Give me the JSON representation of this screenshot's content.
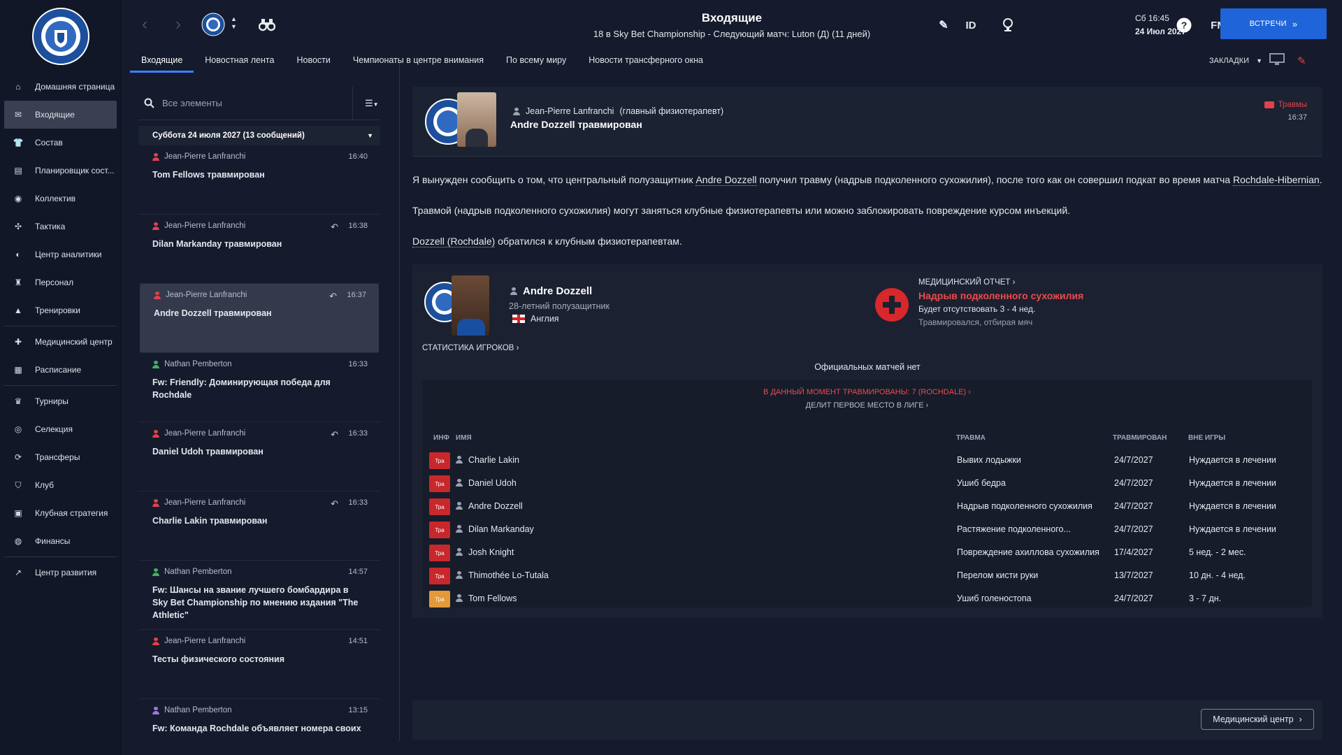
{
  "header": {
    "title": "Входящие",
    "subtitle": "18 в Sky Bet Championship - Следующий матч: Luton (Д) (11 дней)",
    "date_line1": "Сб 16:45",
    "date_line2": "24 Июл 2027",
    "meet_button": "ВСТРЕЧИ",
    "id_label": "ID",
    "fm_label": "FM",
    "bookmarks_label": "ЗАКЛАДКИ"
  },
  "club": {
    "crest_text_top": "ROCHDALE A.F.C.",
    "crest_text_bottom": "THE DALE"
  },
  "tabs": [
    {
      "label": "Входящие"
    },
    {
      "label": "Новостная лента"
    },
    {
      "label": "Новости"
    },
    {
      "label": "Чемпионаты в центре внимания"
    },
    {
      "label": "По всему миру"
    },
    {
      "label": "Новости трансферного окна"
    }
  ],
  "sidebar": {
    "items": [
      {
        "label": "Домашняя страница",
        "icon": "home-icon"
      },
      {
        "label": "Входящие",
        "icon": "inbox-icon"
      },
      {
        "label": "Состав",
        "icon": "shirt-icon"
      },
      {
        "label": "Планировщик сост...",
        "icon": "planner-icon"
      },
      {
        "label": "Коллектив",
        "icon": "group-icon"
      },
      {
        "label": "Тактика",
        "icon": "tactics-icon"
      },
      {
        "label": "Центр аналитики",
        "icon": "analytics-icon"
      },
      {
        "label": "Персонал",
        "icon": "staff-icon"
      },
      {
        "label": "Тренировки",
        "icon": "training-icon"
      },
      {
        "label": "Медицинский центр",
        "icon": "medical-icon"
      },
      {
        "label": "Расписание",
        "icon": "calendar-icon"
      },
      {
        "label": "Турниры",
        "icon": "trophy-icon"
      },
      {
        "label": "Селекция",
        "icon": "binoculars-icon"
      },
      {
        "label": "Трансферы",
        "icon": "transfer-icon"
      },
      {
        "label": "Клуб",
        "icon": "shield-icon"
      },
      {
        "label": "Клубная стратегия",
        "icon": "briefcase-icon"
      },
      {
        "label": "Финансы",
        "icon": "coins-icon"
      },
      {
        "label": "Центр развития",
        "icon": "development-icon"
      }
    ]
  },
  "inbox": {
    "search_placeholder": "Все элементы",
    "group_label": "Суббота 24 июля 2027 (13 сообщений)",
    "messages": [
      {
        "sender": "Jean-Pierre Lanfranchi",
        "time": "16:40",
        "subject": "Tom Fellows травмирован",
        "sender_color": "#e0434a"
      },
      {
        "sender": "Jean-Pierre Lanfranchi",
        "time": "16:38",
        "subject": "Dilan Markanday травмирован",
        "sender_color": "#e0434a"
      },
      {
        "sender": "Jean-Pierre Lanfranchi",
        "time": "16:37",
        "subject": "Andre Dozzell травмирован",
        "sender_color": "#e0434a"
      },
      {
        "sender": "Nathan Pemberton",
        "time": "16:33",
        "subject": "Fw: Friendly: Доминирующая победа для Rochdale",
        "sender_color": "#3fb35f"
      },
      {
        "sender": "Jean-Pierre Lanfranchi",
        "time": "16:33",
        "subject": "Daniel Udoh травмирован",
        "sender_color": "#e0434a"
      },
      {
        "sender": "Jean-Pierre Lanfranchi",
        "time": "16:33",
        "subject": "Charlie Lakin травмирован",
        "sender_color": "#e0434a"
      },
      {
        "sender": "Nathan Pemberton",
        "time": "14:57",
        "subject": "Fw: Шансы на звание лучшего бомбардира в Sky Bet Championship по мнению издания \"The Athletic\"",
        "sender_color": "#3fb35f"
      },
      {
        "sender": "Jean-Pierre Lanfranchi",
        "time": "14:51",
        "subject": "Тесты физического состояния",
        "sender_color": "#e0434a"
      },
      {
        "sender": "Nathan Pemberton",
        "time": "13:15",
        "subject": "Fw: Команда Rochdale объявляет номера своих",
        "sender_color": "#9a7bd8"
      }
    ]
  },
  "message": {
    "from": "Jean-Pierre Lanfranchi",
    "role": "(главный физиотерапевт)",
    "title": "Andre Dozzell травмирован",
    "tag": "Травмы",
    "time": "16:37",
    "p1_a": "Я вынужден сообщить о том, что центральный полузащитник ",
    "p1_link": "Andre Dozzell",
    "p1_b": " получил травму (надрыв подколенного сухожилия), после того как он совершил подкат во время матча ",
    "p1_link2": "Rochdale-Hibernian",
    "p1_c": ".",
    "p2": "Травмой (надрыв подколенного сухожилия) могут заняться клубные физиотерапевты или можно заблокировать повреждение курсом инъекций.",
    "p3_link": "Dozzell (Rochdale)",
    "p3_b": " обратился к клубным физиотерапевтам."
  },
  "player": {
    "name": "Andre Dozzell",
    "desc": "28-летний полузащитник",
    "nation": "Англия",
    "report_label": "МЕДИЦИНСКИЙ ОТЧЕТ",
    "injury": "Надрыв подколенного сухожилия",
    "absence": "Будет отсутствовать 3 - 4 нед.",
    "cause": "Травмировался, отбирая мяч",
    "stats_label": "СТАТИСТИКА ИГРОКОВ",
    "no_matches": "Официальных матчей нет"
  },
  "injured": {
    "header1": "В ДАННЫЙ МОМЕНТ ТРАВМИРОВАНЫ: 7 (ROCHDALE)",
    "header2": "ДЕЛИТ ПЕРВОЕ МЕСТО В ЛИГЕ",
    "col_info": "ИНФ",
    "col_name": "ИМЯ",
    "col_injury": "ТРАВМА",
    "col_date": "ТРАВМИРОВАН",
    "col_out": "ВНЕ ИГРЫ",
    "rows": [
      {
        "badge": "Тра",
        "name": "Charlie Lakin",
        "injury": "Вывих лодыжки",
        "date": "24/7/2027",
        "out": "Нуждается в лечении",
        "color": "#c8282b"
      },
      {
        "badge": "Тра",
        "name": "Daniel Udoh",
        "injury": "Ушиб бедра",
        "date": "24/7/2027",
        "out": "Нуждается в лечении",
        "color": "#c8282b"
      },
      {
        "badge": "Тра",
        "name": "Andre Dozzell",
        "injury": "Надрыв подколенного сухожилия",
        "date": "24/7/2027",
        "out": "Нуждается в лечении",
        "color": "#c8282b"
      },
      {
        "badge": "Тра",
        "name": "Dilan Markanday",
        "injury": "Растяжение подколенного...",
        "date": "24/7/2027",
        "out": "Нуждается в лечении",
        "color": "#c8282b"
      },
      {
        "badge": "Тра",
        "name": "Josh Knight",
        "injury": "Повреждение ахиллова сухожилия",
        "date": "17/4/2027",
        "out": "5 нед. - 2 мес.",
        "color": "#c8282b"
      },
      {
        "badge": "Тра",
        "name": "Thimothée Lo-Tutala",
        "injury": "Перелом кисти руки",
        "date": "13/7/2027",
        "out": "10 дн. - 4 нед.",
        "color": "#c8282b"
      },
      {
        "badge": "Тра",
        "name": "Tom Fellows",
        "injury": "Ушиб голеностопа",
        "date": "24/7/2027",
        "out": "3 - 7 дн.",
        "color": "#e59a3a"
      }
    ]
  },
  "footer": {
    "medical_center_button": "Медицинский центр"
  }
}
